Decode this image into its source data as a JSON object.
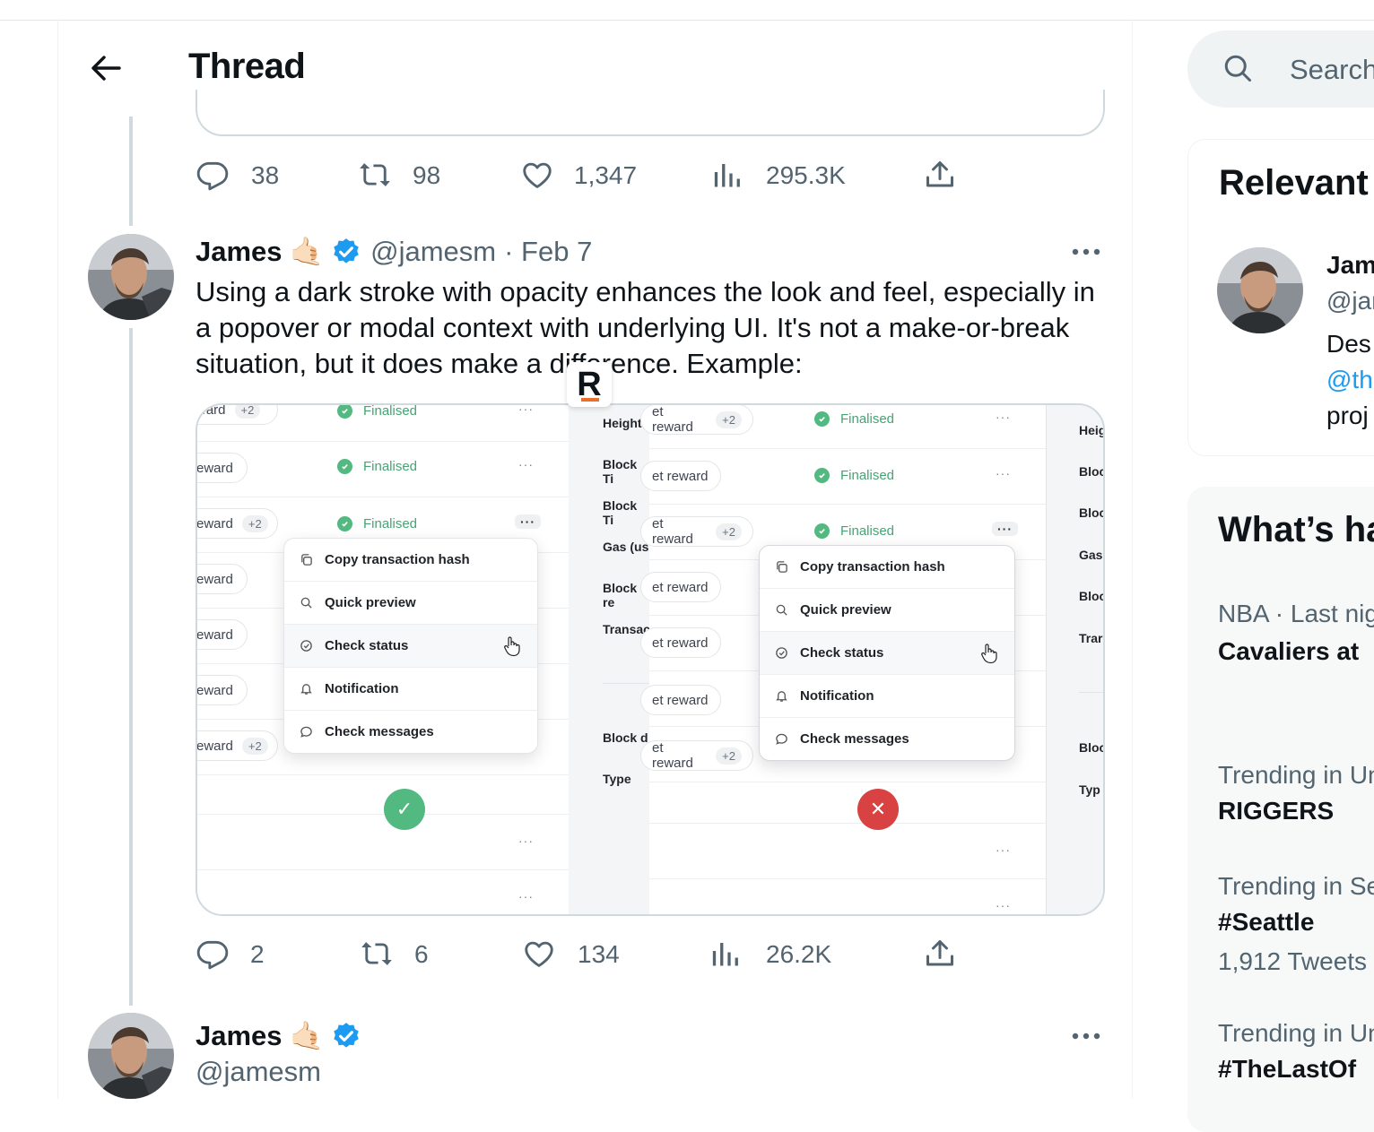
{
  "header": {
    "title": "Thread"
  },
  "prev_tweet": {
    "replies": "38",
    "retweets": "98",
    "likes": "1,347",
    "views": "295.3K"
  },
  "tweet": {
    "name": "James",
    "emoji": "🤙🏻",
    "handle": "@jamesm",
    "date": "· Feb 7",
    "text": "Using a dark stroke with opacity enhances the look and feel, especially in a popover or modal context with underlying UI. It's not a make-or-break situation, but it does make a difference. Example:",
    "replies": "2",
    "retweets": "6",
    "likes": "134",
    "views": "26.2K",
    "media": {
      "chip_plus": "+2",
      "status": "Finalised",
      "menu_items": [
        "Copy transaction hash",
        "Quick preview",
        "Check status",
        "Notification",
        "Check messages"
      ],
      "left_chip_labels": [
        "ward",
        "eward",
        "eward",
        "eward",
        "eward",
        "eward",
        "eward"
      ],
      "right_chip_label": "et reward",
      "side_labels": [
        "Height",
        "Block Ti",
        "Block Ti",
        "Gas (us",
        "Block re",
        "Transac",
        "Block d",
        "Type"
      ],
      "far_labels": [
        "Heig",
        "Bloc",
        "Bloc",
        "Gas",
        "Bloc",
        "Trar",
        "Bloc",
        "Typ"
      ],
      "ok_glyph": "✓",
      "x_glyph": "✕",
      "logo_letter": "R"
    }
  },
  "next_tweet": {
    "name": "James",
    "emoji": "🤙🏻",
    "handle": "@jamesm"
  },
  "sidebar": {
    "search_placeholder": "Search",
    "relevant": {
      "heading": "Relevant",
      "name": "Jam",
      "handle": "@jar",
      "bio_line1": "Des",
      "bio_link": "@th",
      "bio_line3": "proj"
    },
    "whats_happening": {
      "heading": "What’s ha",
      "trends": [
        {
          "context": "NBA · Last nigl",
          "title": "Cavaliers at",
          "count": ""
        },
        {
          "context": "Trending in Uni",
          "title": "RIGGERS",
          "count": ""
        },
        {
          "context": "Trending in Sea",
          "title": "#Seattle",
          "count": "1,912 Tweets"
        },
        {
          "context": "Trending in Uni",
          "title": "#TheLastOf",
          "count": ""
        }
      ]
    }
  },
  "colors": {
    "accent": "#1d9bf0",
    "verified": "#1d9bf0",
    "text_secondary": "#536471",
    "finalised": "#52b981",
    "error": "#d94242"
  },
  "icons": [
    "back-arrow-icon",
    "reply-icon",
    "retweet-icon",
    "like-icon",
    "views-icon",
    "share-icon",
    "verified-badge-icon",
    "more-icon",
    "search-icon"
  ]
}
